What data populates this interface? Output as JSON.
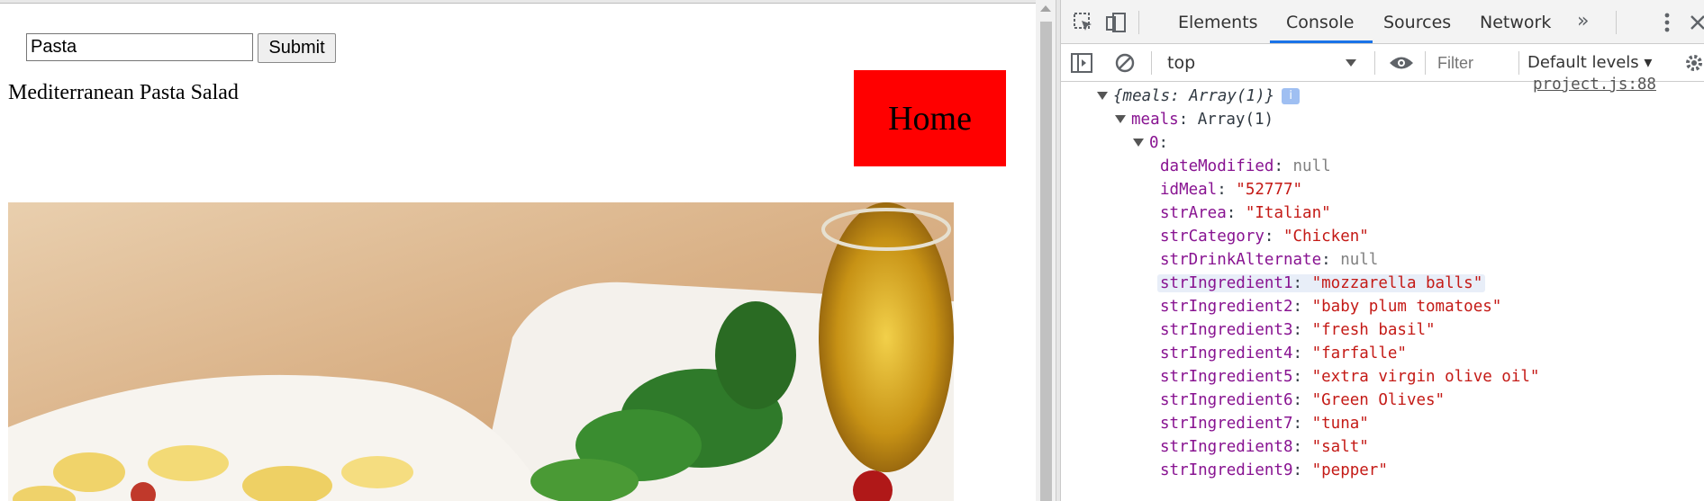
{
  "page": {
    "search": {
      "value": "Pasta"
    },
    "submit_label": "Submit",
    "meal_title": "Mediterranean Pasta Salad",
    "home_label": "Home"
  },
  "devtools": {
    "tabs": [
      {
        "label": "Elements",
        "active": false
      },
      {
        "label": "Console",
        "active": true
      },
      {
        "label": "Sources",
        "active": false
      },
      {
        "label": "Network",
        "active": false
      }
    ],
    "more_tabs_glyph": "»",
    "context": "top",
    "filter_placeholder": "Filter",
    "levels_label": "Default levels ▾",
    "source_link": "project.js:88",
    "colors": {
      "key": "#881391",
      "string": "#c41a16",
      "null": "#808080",
      "accent": "#1a73e8",
      "home_bg": "#ff0000"
    }
  },
  "console": {
    "root_label": "{meals: Array(1)}",
    "info_icon": "i",
    "meals_key": "meals",
    "meals_val": "Array(1)",
    "index_key": "0",
    "fields": [
      {
        "key": "dateModified",
        "value": "null",
        "kind": "null"
      },
      {
        "key": "idMeal",
        "value": "\"52777\"",
        "kind": "string"
      },
      {
        "key": "strArea",
        "value": "\"Italian\"",
        "kind": "string"
      },
      {
        "key": "strCategory",
        "value": "\"Chicken\"",
        "kind": "string"
      },
      {
        "key": "strDrinkAlternate",
        "value": "null",
        "kind": "null"
      },
      {
        "key": "strIngredient1",
        "value": "\"mozzarella balls\"",
        "kind": "string"
      },
      {
        "key": "strIngredient2",
        "value": "\"baby plum tomatoes\"",
        "kind": "string"
      },
      {
        "key": "strIngredient3",
        "value": "\"fresh basil\"",
        "kind": "string"
      },
      {
        "key": "strIngredient4",
        "value": "\"farfalle\"",
        "kind": "string"
      },
      {
        "key": "strIngredient5",
        "value": "\"extra virgin olive oil\"",
        "kind": "string"
      },
      {
        "key": "strIngredient6",
        "value": "\"Green Olives\"",
        "kind": "string"
      },
      {
        "key": "strIngredient7",
        "value": "\"tuna\"",
        "kind": "string"
      },
      {
        "key": "strIngredient8",
        "value": "\"salt\"",
        "kind": "string"
      },
      {
        "key": "strIngredient9",
        "value": "\"pepper\"",
        "kind": "string"
      }
    ]
  }
}
